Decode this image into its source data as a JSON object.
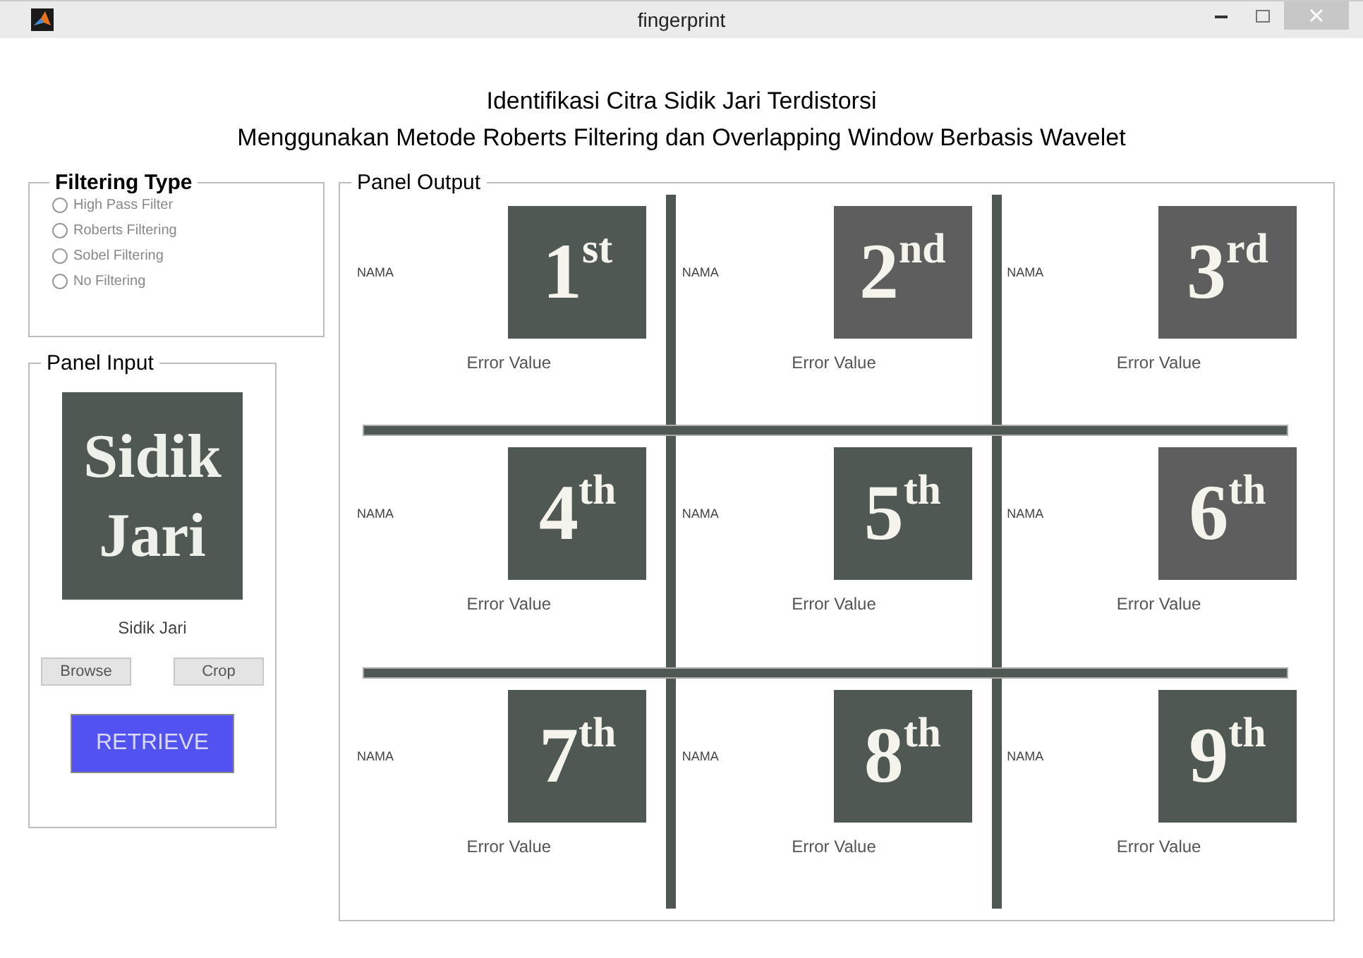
{
  "window": {
    "title": "fingerprint"
  },
  "heading": [
    "Identifikasi Citra Sidik Jari Terdistorsi",
    "Menggunakan Metode Roberts Filtering dan Overlapping Window Berbasis Wavelet"
  ],
  "filtering_type": {
    "title": "Filtering Type",
    "options": [
      {
        "label": "High Pass Filter",
        "selected": false,
        "disabled": true
      },
      {
        "label": "Roberts Filtering",
        "selected": false,
        "disabled": true
      },
      {
        "label": "Sobel Filtering",
        "selected": false,
        "disabled": true
      },
      {
        "label": "No Filtering",
        "selected": false,
        "disabled": true
      }
    ]
  },
  "panel_input": {
    "title": "Panel Input",
    "image_text": [
      "Sidik",
      "Jari"
    ],
    "caption": "Sidik Jari",
    "buttons": [
      "Browse",
      "Crop"
    ],
    "retrieve": "RETRIEVE"
  },
  "panel_output": {
    "title": "Panel Output",
    "results": [
      {
        "name": "NAMA",
        "rank": "1$^{st}$",
        "error": "Error Value"
      },
      {
        "name": "NAMA",
        "rank": "2$^{nd}$",
        "error": "Error Value"
      },
      {
        "name": "NAMA",
        "rank": "3$^{rd}$",
        "error": "Error Value"
      },
      {
        "name": "NAMA",
        "rank": "4$^{th}$",
        "error": "Error Value"
      },
      {
        "name": "NAMA",
        "rank": "5$^{th}$",
        "error": "Error Value"
      },
      {
        "name": "NAMA",
        "rank": "6$^{th}$",
        "error": "Error Value"
      },
      {
        "name": "NAMA",
        "rank": "7$^{th}$",
        "error": "Error Value"
      },
      {
        "name": "NAMA",
        "rank": "8$^{th}$",
        "error": "Error Value"
      },
      {
        "name": "NAMA",
        "rank": "9$^{th}$",
        "error": "Error Value"
      }
    ]
  }
}
